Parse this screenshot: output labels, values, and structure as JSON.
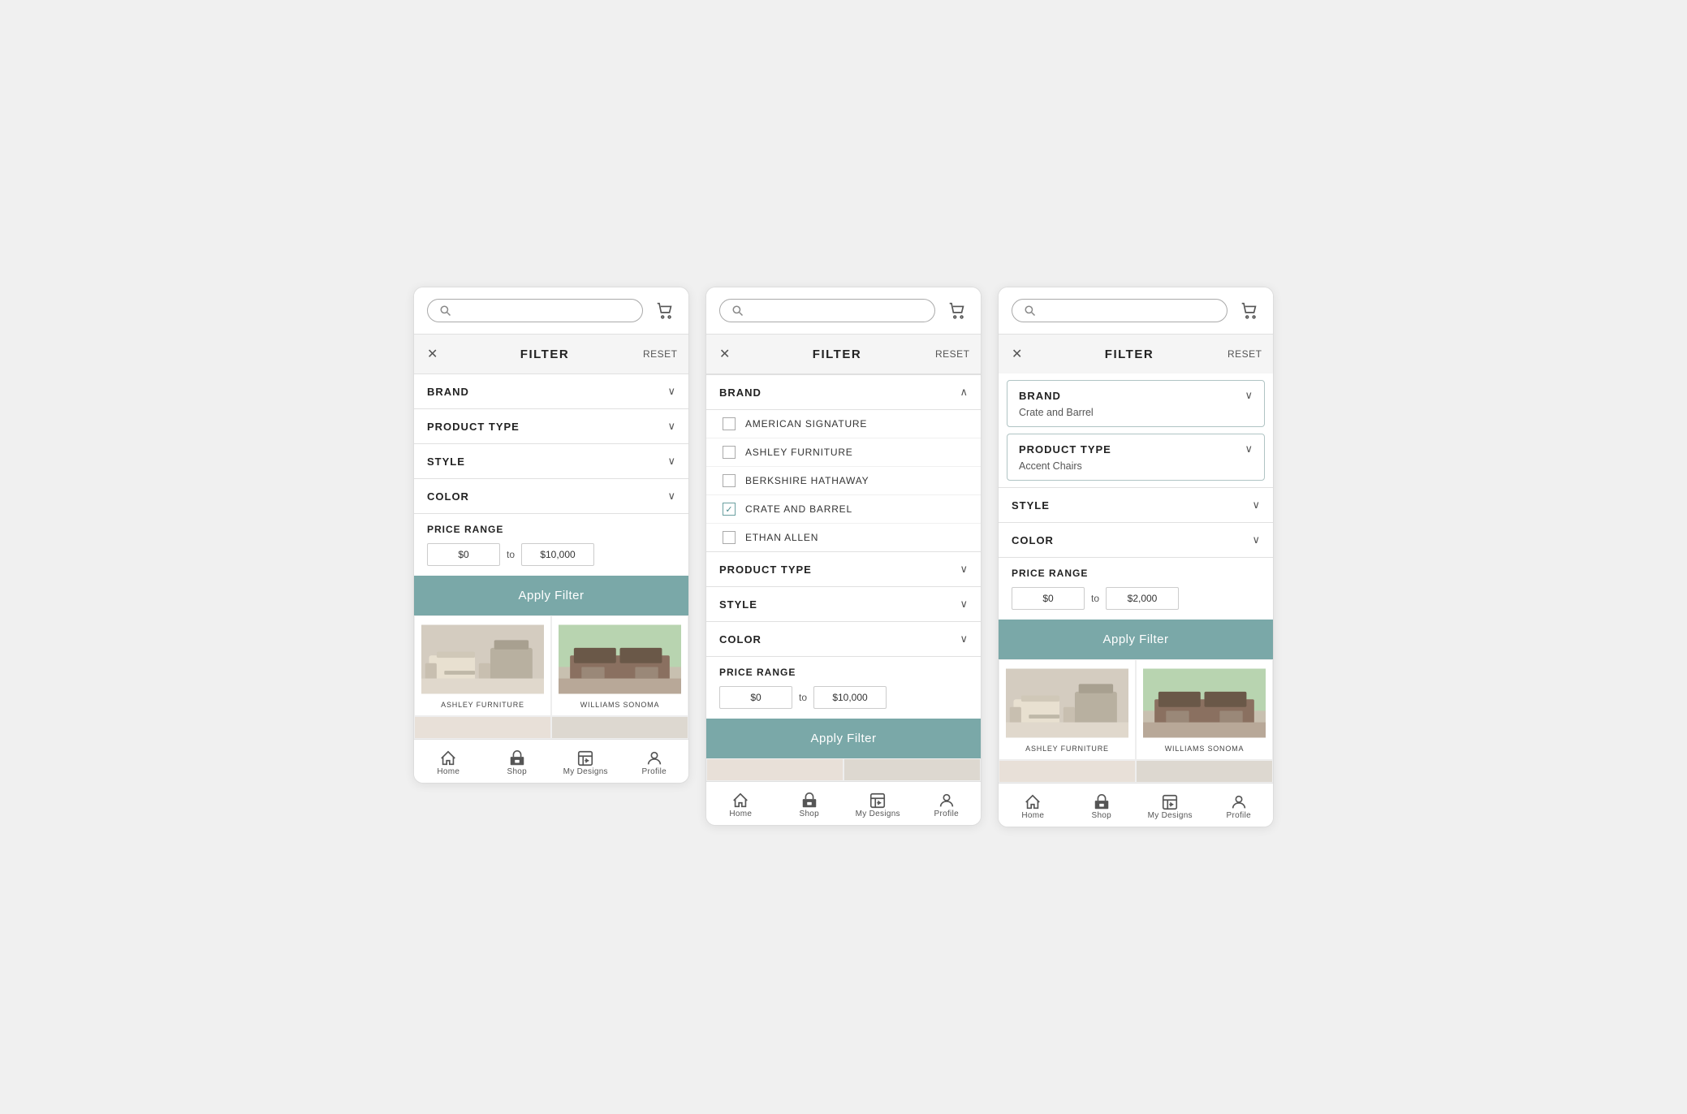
{
  "screens": [
    {
      "id": "screen1",
      "header": {
        "search_placeholder": "Search",
        "cart_label": "Cart"
      },
      "filter": {
        "title": "FILTER",
        "reset_label": "RESET",
        "close_label": "×",
        "rows": [
          {
            "label": "BRAND",
            "expanded": false,
            "value": ""
          },
          {
            "label": "PRODUCT TYPE",
            "expanded": false,
            "value": ""
          },
          {
            "label": "STYLE",
            "expanded": false,
            "value": ""
          },
          {
            "label": "COLOR",
            "expanded": false,
            "value": ""
          }
        ],
        "price_range": {
          "label": "PRICE RANGE",
          "min": "$0",
          "max": "$10,000",
          "to": "to"
        },
        "apply_label": "Apply Filter"
      },
      "products": [
        {
          "name": "ASHLEY FURNITURE",
          "color1": "#c8bfb0",
          "color2": "#b8a898"
        },
        {
          "name": "WILLIAMS SONOMA",
          "color1": "#5a4a3a",
          "color2": "#8a7a6a"
        }
      ],
      "nav": [
        {
          "label": "Home",
          "icon": "🏠"
        },
        {
          "label": "Shop",
          "icon": "🪑"
        },
        {
          "label": "My Designs",
          "icon": "🖼️"
        },
        {
          "label": "Profile",
          "icon": "👤"
        }
      ]
    },
    {
      "id": "screen2",
      "header": {
        "search_placeholder": "Search",
        "cart_label": "Cart"
      },
      "filter": {
        "title": "FILTER",
        "reset_label": "RESET",
        "close_label": "×",
        "brand_expanded": true,
        "brand_options": [
          {
            "label": "AMERICAN SIGNATURE",
            "checked": false
          },
          {
            "label": "ASHLEY FURNITURE",
            "checked": false
          },
          {
            "label": "BERKSHIRE HATHAWAY",
            "checked": false
          },
          {
            "label": "CRATE AND BARREL",
            "checked": true
          },
          {
            "label": "ETHAN ALLEN",
            "checked": false
          }
        ],
        "rows_below": [
          {
            "label": "PRODUCT TYPE",
            "expanded": false
          },
          {
            "label": "STYLE",
            "expanded": false
          },
          {
            "label": "COLOR",
            "expanded": false
          }
        ],
        "price_range": {
          "label": "PRICE RANGE",
          "min": "$0",
          "max": "$10,000",
          "to": "to"
        },
        "apply_label": "Apply Filter"
      },
      "nav": [
        {
          "label": "Home",
          "icon": "🏠"
        },
        {
          "label": "Shop",
          "icon": "🪑"
        },
        {
          "label": "My Designs",
          "icon": "🖼️"
        },
        {
          "label": "Profile",
          "icon": "👤"
        }
      ]
    },
    {
      "id": "screen3",
      "header": {
        "search_placeholder": "Search",
        "cart_label": "Cart"
      },
      "filter": {
        "title": "FILTER",
        "reset_label": "RESET",
        "close_label": "×",
        "expanded_rows": [
          {
            "label": "BRAND",
            "expanded": true,
            "value": "Crate and Barrel"
          },
          {
            "label": "PRODUCT TYPE",
            "expanded": true,
            "value": "Accent Chairs"
          }
        ],
        "rows_below": [
          {
            "label": "STYLE",
            "expanded": false
          },
          {
            "label": "COLOR",
            "expanded": false
          }
        ],
        "price_range": {
          "label": "PRICE RANGE",
          "min": "$0",
          "max": "$2,000",
          "to": "to"
        },
        "apply_label": "Apply Filter"
      },
      "products": [
        {
          "name": "ASHLEY FURNITURE",
          "color1": "#c8bfb0",
          "color2": "#b8a898"
        },
        {
          "name": "WILLIAMS SONOMA",
          "color1": "#5a4a3a",
          "color2": "#8a7a6a"
        }
      ],
      "nav": [
        {
          "label": "Home",
          "icon": "🏠"
        },
        {
          "label": "Shop",
          "icon": "🪑"
        },
        {
          "label": "My Designs",
          "icon": "🖼️"
        },
        {
          "label": "Profile",
          "icon": "👤"
        }
      ]
    }
  ]
}
